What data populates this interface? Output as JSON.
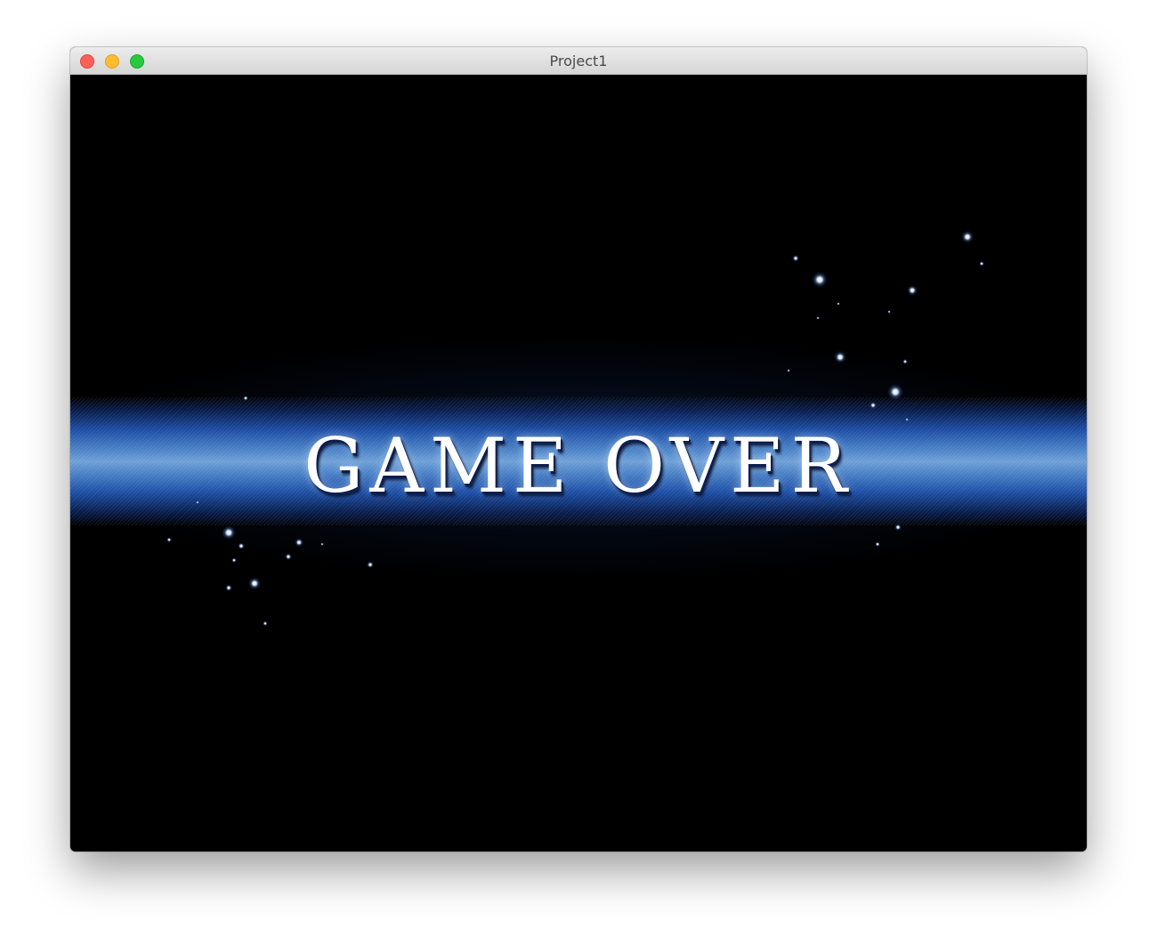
{
  "window": {
    "title": "Project1"
  },
  "game": {
    "message": "GAME OVER"
  },
  "colors": {
    "background": "#000000",
    "band": "#4f86c9",
    "text": "#ffffff"
  }
}
